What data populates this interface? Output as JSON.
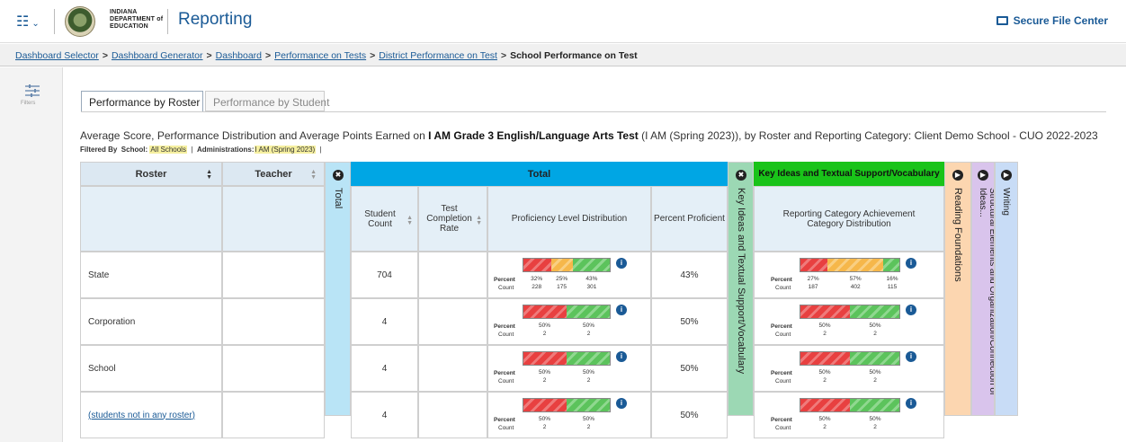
{
  "header": {
    "app_name": "Reporting",
    "brand_lines": [
      "INDIANA",
      "DEPARTMENT of",
      "EDUCATION"
    ],
    "secure_file_center": "Secure File Center"
  },
  "breadcrumb": {
    "items": [
      "Dashboard Selector",
      "Dashboard Generator",
      "Dashboard",
      "Performance on Tests",
      "District Performance on Test"
    ],
    "current": "School Performance on Test",
    "separator": ">"
  },
  "sidebar": {
    "filters_label": "Filters"
  },
  "tabs": [
    "Performance by Roster",
    "Performance by Student"
  ],
  "report": {
    "title_prefix": "Average Score, Performance Distribution and Average Points Earned on",
    "title_bold": "I AM Grade 3 English/Language Arts Test",
    "title_suffix": "(I AM (Spring 2023)), by Roster and Reporting Category: Client Demo School - CUO 2022-2023",
    "filtered_by": "Filtered By",
    "school_label": "School:",
    "school_value": "All Schools",
    "admin_label": "Administrations:",
    "admin_value": "I AM (Spring 2023)",
    "pipe": "|"
  },
  "table": {
    "col_roster": "Roster",
    "col_teacher": "Teacher",
    "total_collapsed": "Total",
    "group_total": "Total",
    "col_student_count": "Student Count",
    "col_completion": "Test Completion Rate",
    "col_proficiency": "Proficiency Level Distribution",
    "col_percent": "Percent Proficient",
    "kitsv_collapsed": "Key Ideas and Textual Support/Vocabulary",
    "group_kitsv": "Key Ideas and Textual Support/Vocabulary",
    "col_rcacd": "Reporting Category Achievement Category Distribution",
    "reading_foundations": "Reading Foundations",
    "structural": "Structural Elements and Organization/Connection of Ideas...",
    "writing": "Writing",
    "percent_label": "Percent",
    "count_label": "Count",
    "rows": [
      {
        "roster": "State",
        "link": false,
        "student_count": "704",
        "percent_proficient": "43%",
        "prof": [
          {
            "level": "red",
            "percent": "32%",
            "count": "228",
            "frac": 0.32
          },
          {
            "level": "orange",
            "percent": "25%",
            "count": "175",
            "frac": 0.25
          },
          {
            "level": "green",
            "percent": "43%",
            "count": "301",
            "frac": 0.43
          }
        ],
        "rc": [
          {
            "level": "red",
            "percent": "27%",
            "count": "187",
            "frac": 0.27
          },
          {
            "level": "orange",
            "percent": "57%",
            "count": "402",
            "frac": 0.57
          },
          {
            "level": "green",
            "percent": "16%",
            "count": "115",
            "frac": 0.16
          }
        ]
      },
      {
        "roster": "Corporation",
        "link": false,
        "student_count": "4",
        "percent_proficient": "50%",
        "prof": [
          {
            "level": "red",
            "percent": "50%",
            "count": "2",
            "frac": 0.5
          },
          {
            "level": "green",
            "percent": "50%",
            "count": "2",
            "frac": 0.5
          }
        ],
        "rc": [
          {
            "level": "red",
            "percent": "50%",
            "count": "2",
            "frac": 0.5
          },
          {
            "level": "green",
            "percent": "50%",
            "count": "2",
            "frac": 0.5
          }
        ]
      },
      {
        "roster": "School",
        "link": false,
        "student_count": "4",
        "percent_proficient": "50%",
        "prof": [
          {
            "level": "red",
            "percent": "50%",
            "count": "2",
            "frac": 0.5
          },
          {
            "level": "green",
            "percent": "50%",
            "count": "2",
            "frac": 0.5
          }
        ],
        "rc": [
          {
            "level": "red",
            "percent": "50%",
            "count": "2",
            "frac": 0.5
          },
          {
            "level": "green",
            "percent": "50%",
            "count": "2",
            "frac": 0.5
          }
        ]
      },
      {
        "roster": "(students not in any roster)",
        "link": true,
        "student_count": "4",
        "percent_proficient": "50%",
        "prof": [
          {
            "level": "red",
            "percent": "50%",
            "count": "2",
            "frac": 0.5
          },
          {
            "level": "green",
            "percent": "50%",
            "count": "2",
            "frac": 0.5
          }
        ],
        "rc": [
          {
            "level": "red",
            "percent": "50%",
            "count": "2",
            "frac": 0.5
          },
          {
            "level": "green",
            "percent": "50%",
            "count": "2",
            "frac": 0.5
          }
        ]
      }
    ]
  },
  "colors": {
    "total_header": "#00a6e4",
    "kitsv_header": "#19c319",
    "kitsv_col": "#9cd8b4",
    "total_col": "#b9e4f6",
    "reading_col": "#fcd6b0",
    "structural_col": "#d9c4ec",
    "writing_col": "#c8dcf6",
    "link": "#1a5a96"
  }
}
